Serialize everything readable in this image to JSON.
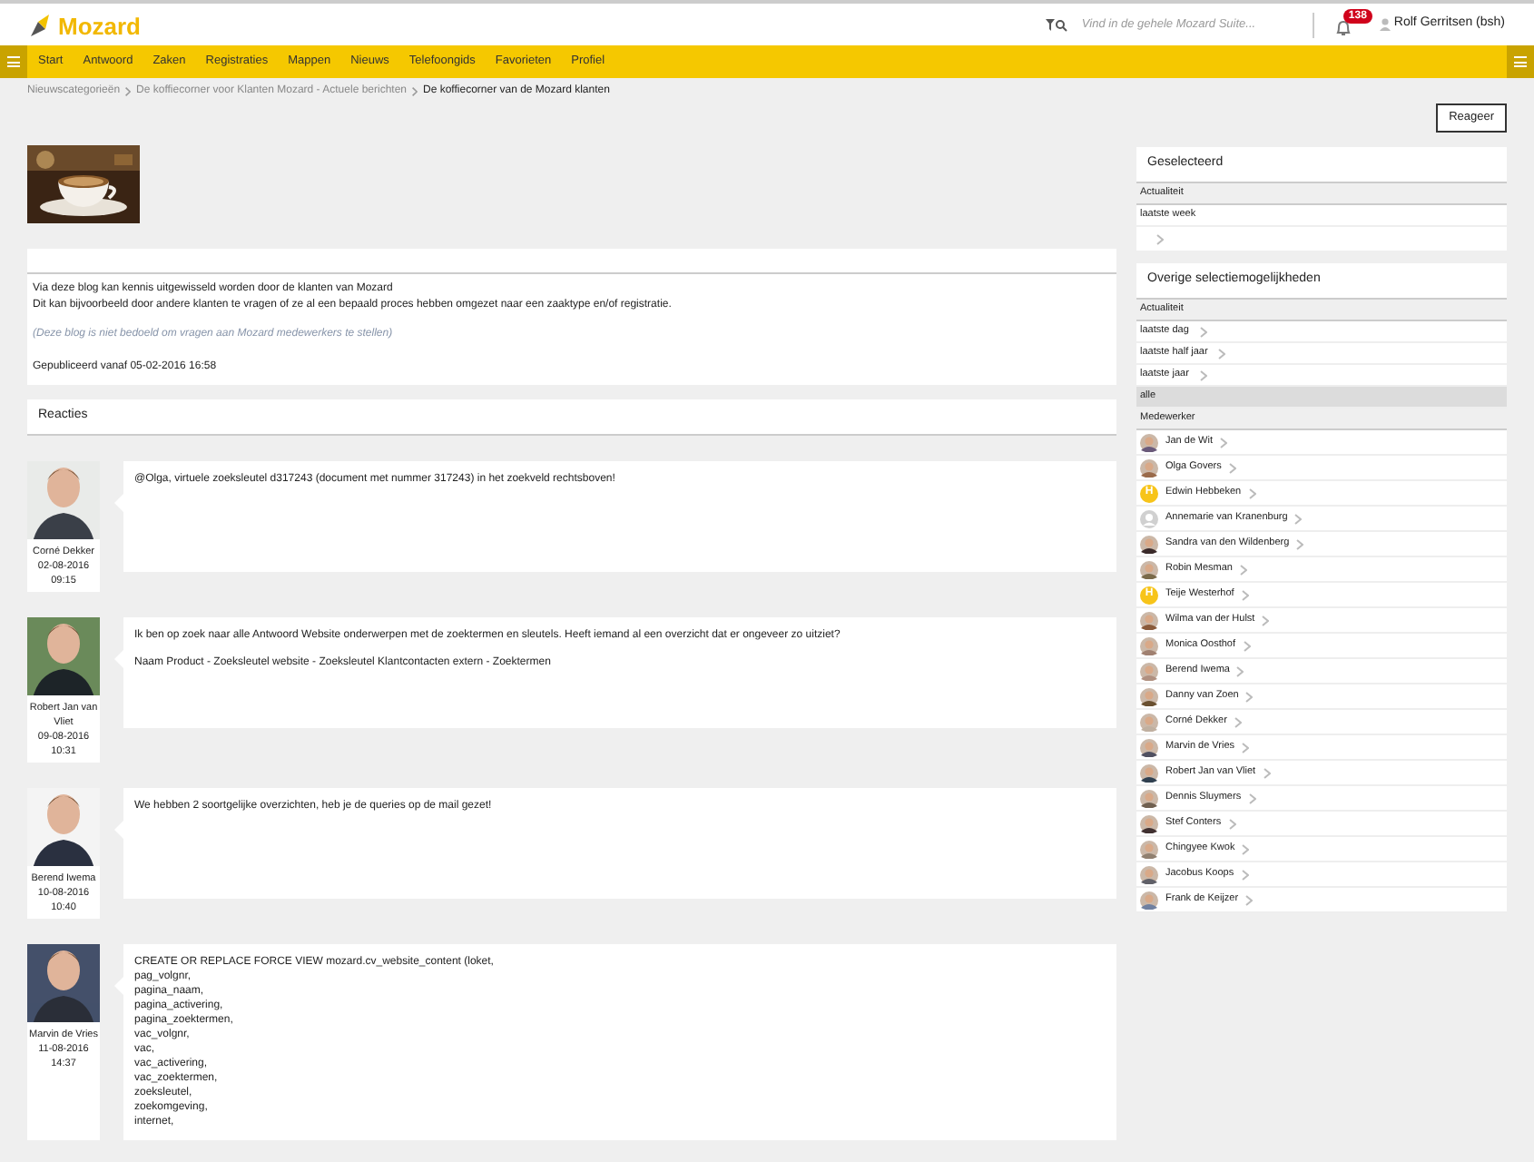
{
  "header": {
    "logo": "Mozard",
    "search_placeholder": "Vind in de gehele Mozard Suite...",
    "notification_count": "138",
    "user": "Rolf Gerritsen (bsh)"
  },
  "nav": [
    "Start",
    "Antwoord",
    "Zaken",
    "Registraties",
    "Mappen",
    "Nieuws",
    "Telefoongids",
    "Favorieten",
    "Profiel"
  ],
  "breadcrumb": [
    {
      "label": "Nieuwscategorieën",
      "current": false
    },
    {
      "label": "De koffiecorner voor Klanten Mozard - Actuele berichten",
      "current": false
    },
    {
      "label": "De koffiecorner van de Mozard klanten",
      "current": true
    }
  ],
  "reply_button": "Reageer",
  "post": {
    "lines": [
      "Via deze blog kan kennis uitgewisseld worden door de klanten van Mozard",
      "Dit kan bijvoorbeeld door andere klanten te vragen of ze al een bepaald proces hebben omgezet naar een zaaktype en/of registratie."
    ],
    "note": "(Deze blog is niet bedoeld om vragen aan Mozard medewerkers te stellen)",
    "published": "Gepubliceerd vanaf 05-02-2016 16:58"
  },
  "reactions_title": "Reacties",
  "comments": [
    {
      "author": "Corné Dekker",
      "date": "02-08-2016",
      "time": "09:15",
      "paragraphs": [
        "@Olga, virtuele zoeksleutel d317243 (document met nummer 317243) in het zoekveld rechtsboven!"
      ]
    },
    {
      "author": "Robert Jan van Vliet",
      "date": "09-08-2016",
      "time": "10:31",
      "paragraphs": [
        "Ik ben op zoek naar alle Antwoord Website onderwerpen met de zoektermen en sleutels. Heeft iemand al een overzicht dat er ongeveer zo uitziet?",
        "Naam Product - Zoeksleutel website - Zoeksleutel Klantcontacten extern - Zoektermen"
      ]
    },
    {
      "author": "Berend Iwema",
      "date": "10-08-2016",
      "time": "10:40",
      "paragraphs": [
        "We hebben 2 soortgelijke overzichten, heb je de queries op de mail gezet!"
      ]
    },
    {
      "author": "Marvin de Vries",
      "date": "11-08-2016",
      "time": "14:37",
      "paragraphs": [
        "CREATE OR REPLACE FORCE VIEW mozard.cv_website_content (loket,\npag_volgnr,\npagina_naam,\npagina_activering,\npagina_zoektermen,\nvac_volgnr,\nvac,\nvac_activering,\nvac_zoektermen,\nzoeksleutel,\nzoekomgeving,\ninternet,"
      ]
    }
  ],
  "sidebar": {
    "selected_title": "Geselecteerd",
    "selected_group": "Actualiteit",
    "selected_items": [
      "laatste week"
    ],
    "other_title": "Overige selectiemogelijkheden",
    "period_group": "Actualiteit",
    "periods": [
      {
        "label": "laatste dag",
        "selected": false
      },
      {
        "label": "laatste half jaar",
        "selected": false
      },
      {
        "label": "laatste jaar",
        "selected": false
      },
      {
        "label": "alle",
        "selected": true
      }
    ],
    "people_group": "Medewerker",
    "people": [
      {
        "name": "Jan de Wit"
      },
      {
        "name": "Olga Govers"
      },
      {
        "name": "Edwin Hebbeken",
        "kind": "initial",
        "initial": "H"
      },
      {
        "name": "Annemarie van Kranenburg",
        "kind": "placeholder"
      },
      {
        "name": "Sandra van den Wildenberg"
      },
      {
        "name": "Robin Mesman"
      },
      {
        "name": "Teije Westerhof",
        "kind": "initial",
        "initial": "H"
      },
      {
        "name": "Wilma van der Hulst"
      },
      {
        "name": "Monica Oosthof"
      },
      {
        "name": "Berend Iwema"
      },
      {
        "name": "Danny van Zoen"
      },
      {
        "name": "Corné Dekker"
      },
      {
        "name": "Marvin de Vries"
      },
      {
        "name": "Robert Jan van Vliet"
      },
      {
        "name": "Dennis Sluymers"
      },
      {
        "name": "Stef Conters"
      },
      {
        "name": "Chingyee Kwok"
      },
      {
        "name": "Jacobus Koops"
      },
      {
        "name": "Frank de Keijzer"
      }
    ]
  }
}
